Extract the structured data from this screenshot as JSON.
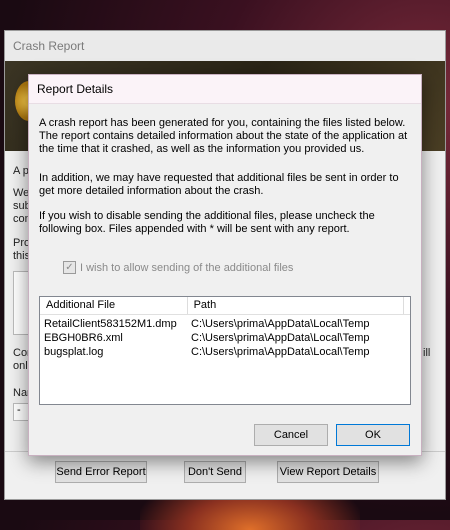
{
  "crash_window": {
    "title": "Crash Report",
    "fragments": [
      "A p",
      "We",
      "sub",
      "con",
      "Pro",
      "this",
      "Cor",
      "onl",
      "Nar",
      "ill"
    ],
    "name_value": "-",
    "buttons": {
      "send_error_report": "Send Error Report",
      "dont_send": "Don't Send",
      "view_report_details": "View Report Details"
    }
  },
  "dialog": {
    "title": "Report Details",
    "paragraph1": "A crash report has been generated for you, containing the files listed below. The report contains detailed information about the state of the application at the time that it crashed, as well as the information you provided us.",
    "paragraph2": "In addition, we may have requested that additional files be sent in order to get more detailed information about the crash.",
    "paragraph3": "If you wish to disable sending the additional files, please uncheck the following box.  Files appended with * will be sent with any report.",
    "checkbox_label": "I wish to allow sending of the additional files",
    "checkbox_checked": true,
    "table": {
      "columns": [
        "Additional File",
        "Path"
      ],
      "rows": [
        {
          "file": "RetailClient583152M1.dmp",
          "path": "C:\\Users\\prima\\AppData\\Local\\Temp"
        },
        {
          "file": "EBGH0BR6.xml",
          "path": "C:\\Users\\prima\\AppData\\Local\\Temp"
        },
        {
          "file": "bugsplat.log",
          "path": "C:\\Users\\prima\\AppData\\Local\\Temp"
        }
      ]
    },
    "buttons": {
      "cancel": "Cancel",
      "ok": "OK"
    }
  }
}
